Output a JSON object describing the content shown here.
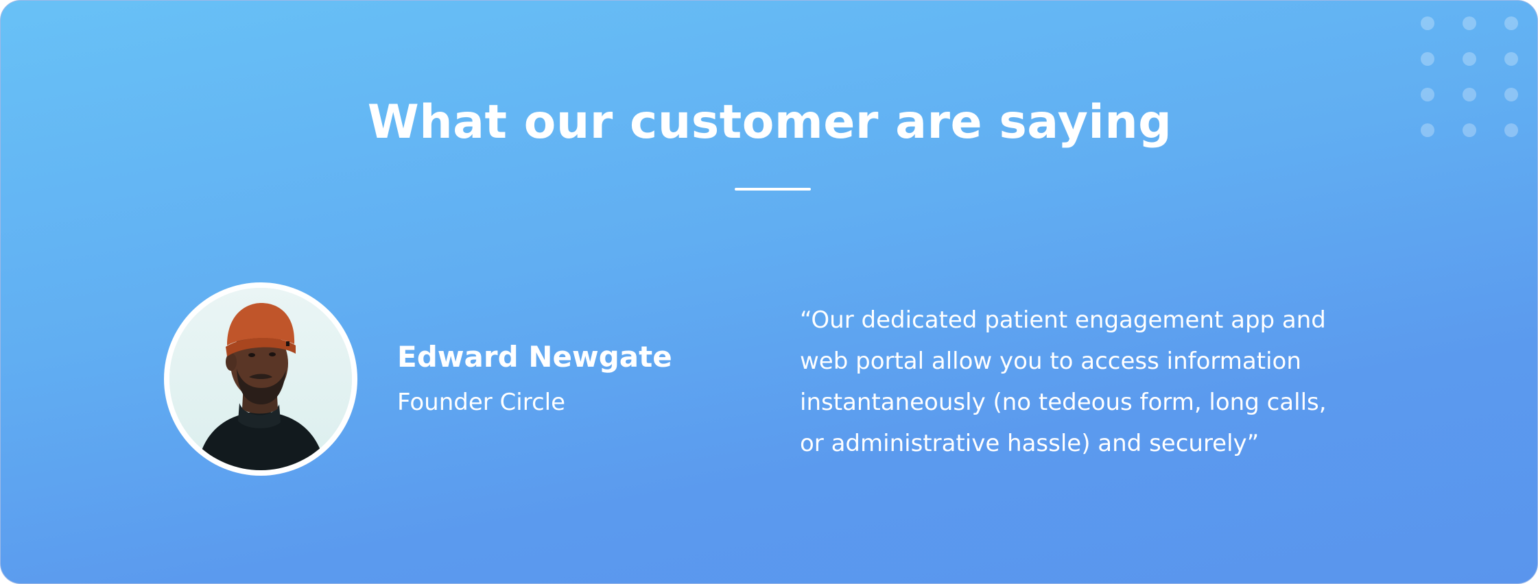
{
  "section": {
    "title": "What our customer are saying"
  },
  "testimonial": {
    "author_name": "Edward Newgate",
    "author_role": "Founder Circle",
    "quote_lines": [
      "“Our dedicated patient engagement app and",
      "web portal allow you to access information",
      "instantaneously (no tedeous form, long calls,",
      "or administrative hassle) and securely”"
    ],
    "avatar_icon": "person-photo-icon"
  },
  "colors": {
    "gradient_top": "#68c1f6",
    "gradient_bottom": "#5a95ed",
    "text": "#ffffff",
    "beanie": "#c0552a",
    "sweater": "#121a1e"
  },
  "decor": {
    "dots_icon": "dot-grid-icon"
  }
}
